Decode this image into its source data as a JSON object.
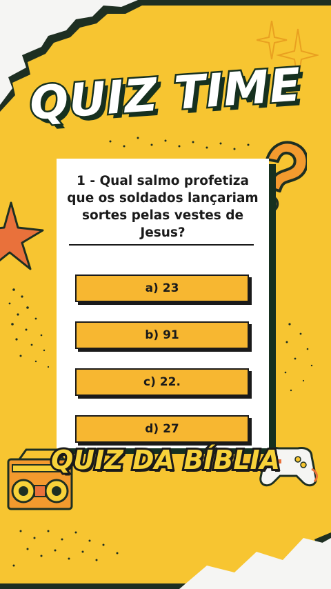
{
  "title": "QUIZ TIME",
  "question": "1 - Qual salmo profetiza que os soldados lançariam sortes pelas vestes de Jesus?",
  "options": [
    {
      "label": "a) 23"
    },
    {
      "label": "b) 91"
    },
    {
      "label": "c) 22."
    },
    {
      "label": "d) 27"
    }
  ],
  "subtitle": "QUIZ DA BÍBLIA",
  "icons": [
    "sparkle-icon",
    "question-mark-icon",
    "star-icon",
    "radio-icon",
    "gamepad-icon"
  ],
  "colors": {
    "accent": "#f7b731",
    "background": "#f7c531",
    "ink": "#16301f",
    "star": "#e9713b",
    "question_mark": "#f39a2e"
  }
}
